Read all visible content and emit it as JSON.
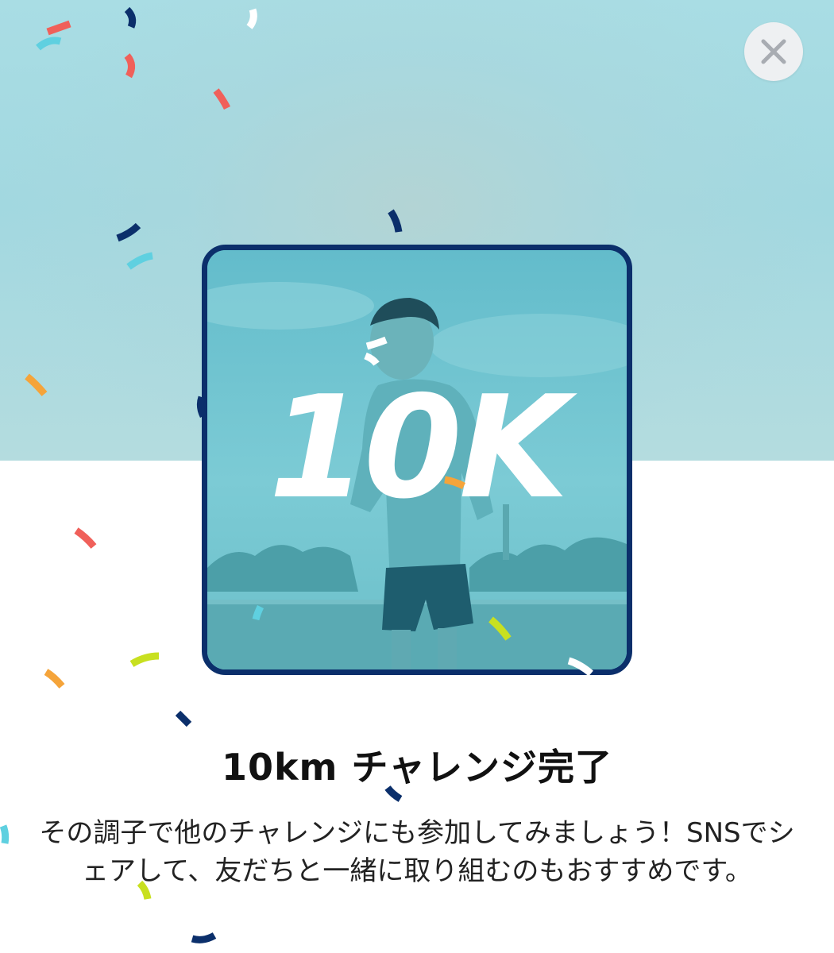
{
  "header": {
    "close_icon": "close-icon"
  },
  "badge": {
    "label": "10K"
  },
  "content": {
    "title": "10km チャレンジ完了",
    "description": "その調子で他のチャレンジにも参加してみましょう！SNSでシェアして、友だちと一緒に取り組むのもおすすめです。"
  },
  "colors": {
    "hero_background": "#a9dde4",
    "badge_border": "#0b2f6b",
    "badge_tint": "#6cc4cf",
    "close_button_bg": "#eef0f2",
    "confetti_navy": "#0b2f6b",
    "confetti_red": "#f0605a",
    "confetti_cyan": "#5fd0e0",
    "confetti_orange": "#f5a43a",
    "confetti_lime": "#c8e020"
  }
}
